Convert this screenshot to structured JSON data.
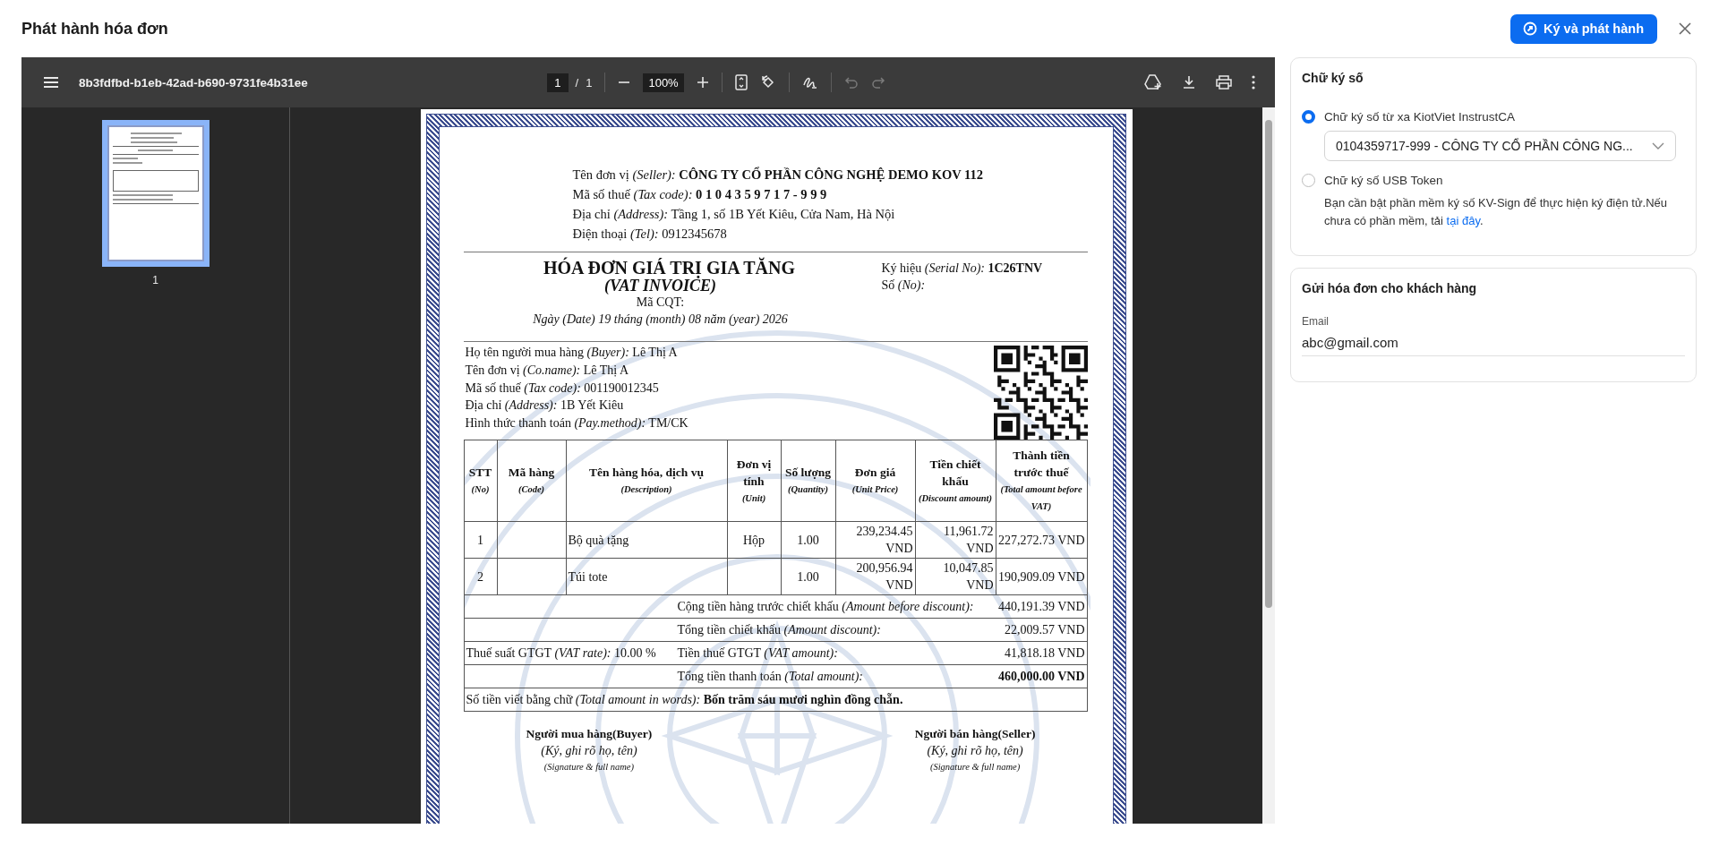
{
  "header": {
    "title": "Phát hành hóa đơn",
    "primary_button": "Ký và phát hành"
  },
  "viewer": {
    "file_name": "8b3fdfbd-b1eb-42ad-b690-9731fe4b31ee",
    "page_current": "1",
    "page_separator": "/",
    "page_total": "1",
    "zoom": "100%",
    "undo_disabled": true,
    "redo_disabled": true,
    "thumbnails": [
      {
        "label": "1",
        "selected": true
      }
    ]
  },
  "invoice": {
    "seller": [
      "Tên đơn vị *(Seller):* **CÔNG TY CỔ PHẦN CÔNG NGHỆ DEMO KOV 112**",
      "Mã số thuế *(Tax code):* **0 1 0 4 3 5 9 7 1 7 - 9 9 9**",
      "Địa chỉ *(Address):* Tầng 1, số 1B Yết Kiêu, Cửa Nam, Hà Nội",
      "Điện thoại *(Tel):* 0912345678"
    ],
    "title": "HÓA ĐƠN GIÁ TRỊ GIA TĂNG",
    "subtitle": "(VAT INVOICE)",
    "authority_code": "Mã CQT:",
    "date": "Ngày (Date) 19 tháng (month) 08 năm (year) 2026",
    "serial": [
      "Ký hiệu *(Serial No):* **1C26TNV**",
      "Số *(No):*"
    ],
    "buyer": [
      "Họ tên người mua hàng *(Buyer):* Lê Thị A",
      "Tên đơn vị *(Co.name):* Lê Thị A",
      "Mã số thuế *(Tax code):* 001190012345",
      "Địa chỉ *(Address):* 1B Yết Kiêu",
      "Hình thức thanh toán *(Pay.method):* TM/CK"
    ],
    "columns": [
      {
        "title": "STT",
        "subtitle": "(No)"
      },
      {
        "title": "Mã hàng",
        "subtitle": "(Code)"
      },
      {
        "title": "Tên hàng hóa, dịch vụ",
        "subtitle": "(Description)"
      },
      {
        "title": "Đơn vị tính",
        "subtitle": "(Unit)"
      },
      {
        "title": "Số lượng",
        "subtitle": "(Quantity)"
      },
      {
        "title": "Đơn giá",
        "subtitle": "(Unit Price)"
      },
      {
        "title": "Tiền chiết khấu",
        "subtitle": "(Discount amount)"
      },
      {
        "title": "Thành tiền trước thuế",
        "subtitle": "(Total amount before VAT)"
      }
    ],
    "rows": [
      {
        "no": "1",
        "description": "Bộ quà tặng",
        "unit": "Hộp",
        "quantity": "1.00",
        "unit_price": "239,234.45 VND",
        "discount": "11,961.72 VND",
        "total": "227,272.73 VND"
      },
      {
        "no": "2",
        "description": "Túi tote",
        "quantity": "1.00",
        "unit_price": "200,956.94 VND",
        "discount": "10,047.85 VND",
        "total": "190,909.09 VND"
      }
    ],
    "summary": [
      {
        "kind": "plain",
        "label": "Cộng tiền hàng trước chiết khấu *(Amount before discount):*",
        "value": "440,191.39 VND"
      },
      {
        "kind": "plain",
        "label": "Tổng tiền chiết khấu *(Amount discount):*",
        "value": "22,009.57 VND"
      },
      {
        "kind": "plain",
        "left": "Thuế suất GTGT *(VAT rate):* 10.00 %",
        "label": "Tiền thuế GTGT *(VAT amount):*",
        "value": "41,818.18 VND"
      },
      {
        "kind": "total",
        "label": "Tổng tiền thanh toán *(Total amount):*",
        "value": "460,000.00 VND"
      }
    ],
    "in_words": "Số tiền viết bằng chữ *(Total amount in words):* **Bốn trăm sáu mươi nghìn đồng chẵn.**",
    "signatures": [
      {
        "title": "Người mua hàng(Buyer)",
        "hint": "(Ký, ghi rõ họ, tên)",
        "hint_en": "(Signature & full name)"
      },
      {
        "title": "Người bán hàng(Seller)",
        "hint": "(Ký, ghi rõ họ, tên)",
        "hint_en": "(Signature & full name)"
      }
    ]
  },
  "signature": {
    "title": "Chữ ký số",
    "options": [
      {
        "label": "Chữ ký số từ xa KiotViet InstrustCA",
        "selected": true,
        "select_value": "0104359717-999 - CÔNG TY CỔ PHẦN CÔNG NG..."
      },
      {
        "label": "Chữ ký số USB Token",
        "selected": false,
        "note": "Bạn cần bật phần mềm ký số KV-Sign để thực hiện ký điện tử.Nếu chưa có phần mềm, tải ",
        "link": "tại đây",
        "note_end": "."
      }
    ]
  },
  "send": {
    "title": "Gửi hóa đơn cho khách hàng",
    "email_label": "Email",
    "email_value": "abc@gmail.com"
  }
}
